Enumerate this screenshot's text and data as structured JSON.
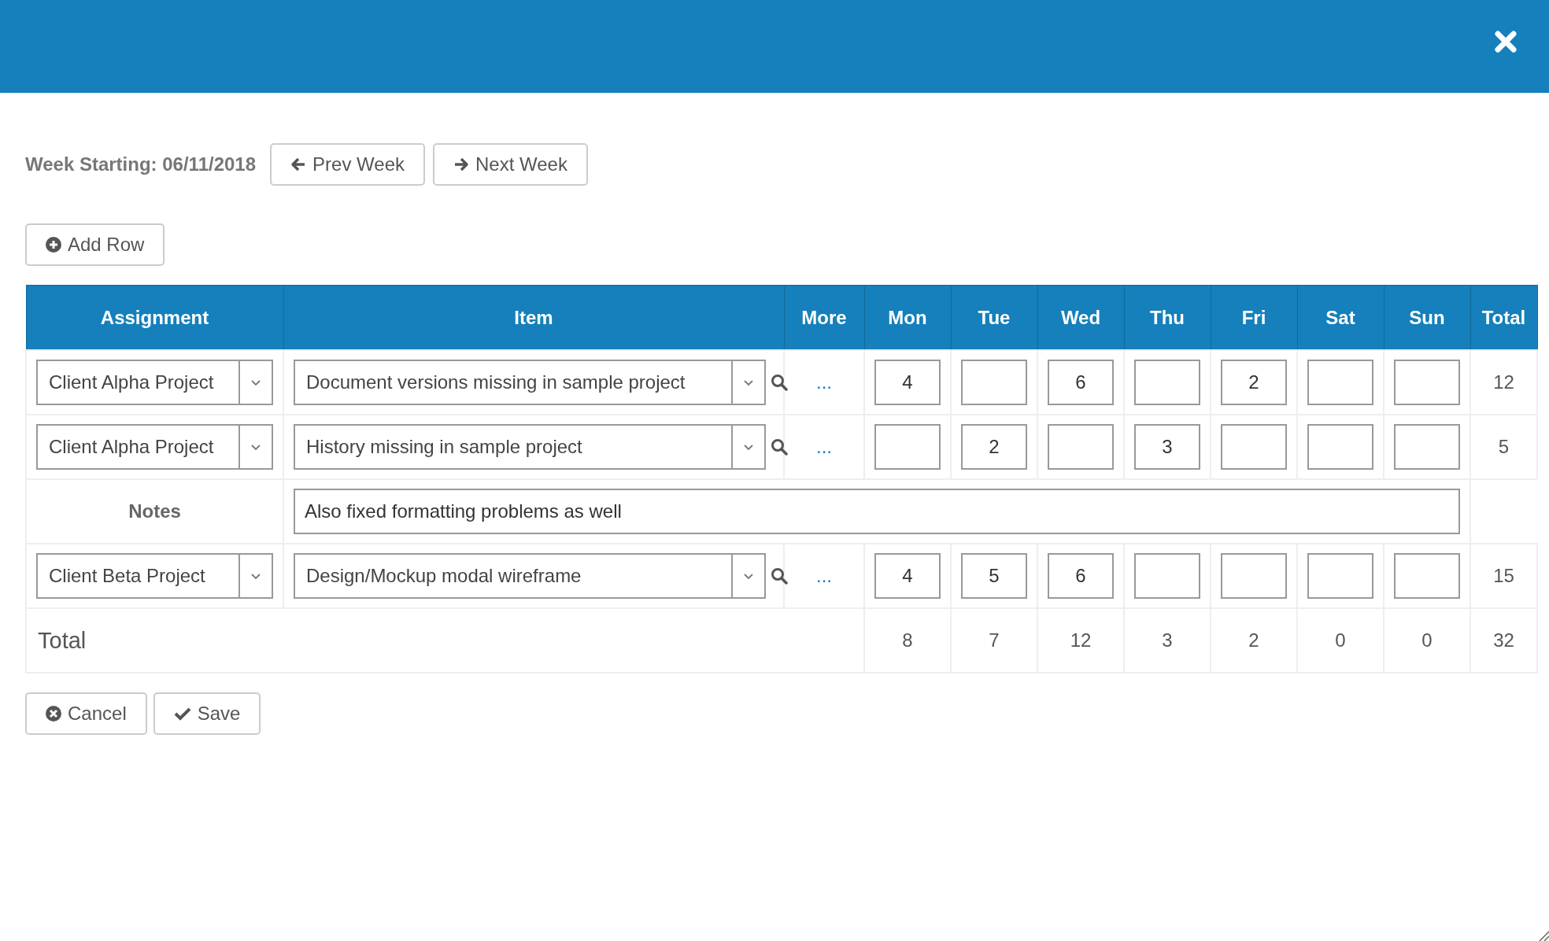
{
  "week": {
    "label": "Week Starting: 06/11/2018",
    "prev": "Prev Week",
    "next": "Next Week"
  },
  "add_row": "Add Row",
  "table": {
    "columns": [
      "Assignment",
      "Item",
      "More",
      "Mon",
      "Tue",
      "Wed",
      "Thu",
      "Fri",
      "Sat",
      "Sun",
      "Total"
    ],
    "rows": [
      {
        "kind": "entry",
        "assignment": "Client Alpha Project",
        "item": "Document versions missing in sample project",
        "more": "...",
        "hours": {
          "mon": "4",
          "wed": "6",
          "fri": "2"
        },
        "total": "12"
      },
      {
        "kind": "entry",
        "assignment": "Client Alpha Project",
        "item": "History missing in sample project",
        "more": "...",
        "hours": {
          "tue": "2",
          "thu": "3"
        },
        "total": "5"
      },
      {
        "kind": "notes",
        "label": "Notes",
        "value": "Also fixed formatting problems as well"
      },
      {
        "kind": "entry",
        "assignment": "Client Beta Project",
        "item": "Design/Mockup modal wireframe",
        "more": "...",
        "hours": {
          "mon": "4",
          "tue": "5",
          "wed": "6"
        },
        "total": "15"
      }
    ],
    "totals": {
      "label": "Total",
      "values": [
        "8",
        "7",
        "12",
        "3",
        "2",
        "0",
        "0"
      ],
      "grand": "32"
    }
  },
  "footer": {
    "cancel": "Cancel",
    "save": "Save"
  }
}
